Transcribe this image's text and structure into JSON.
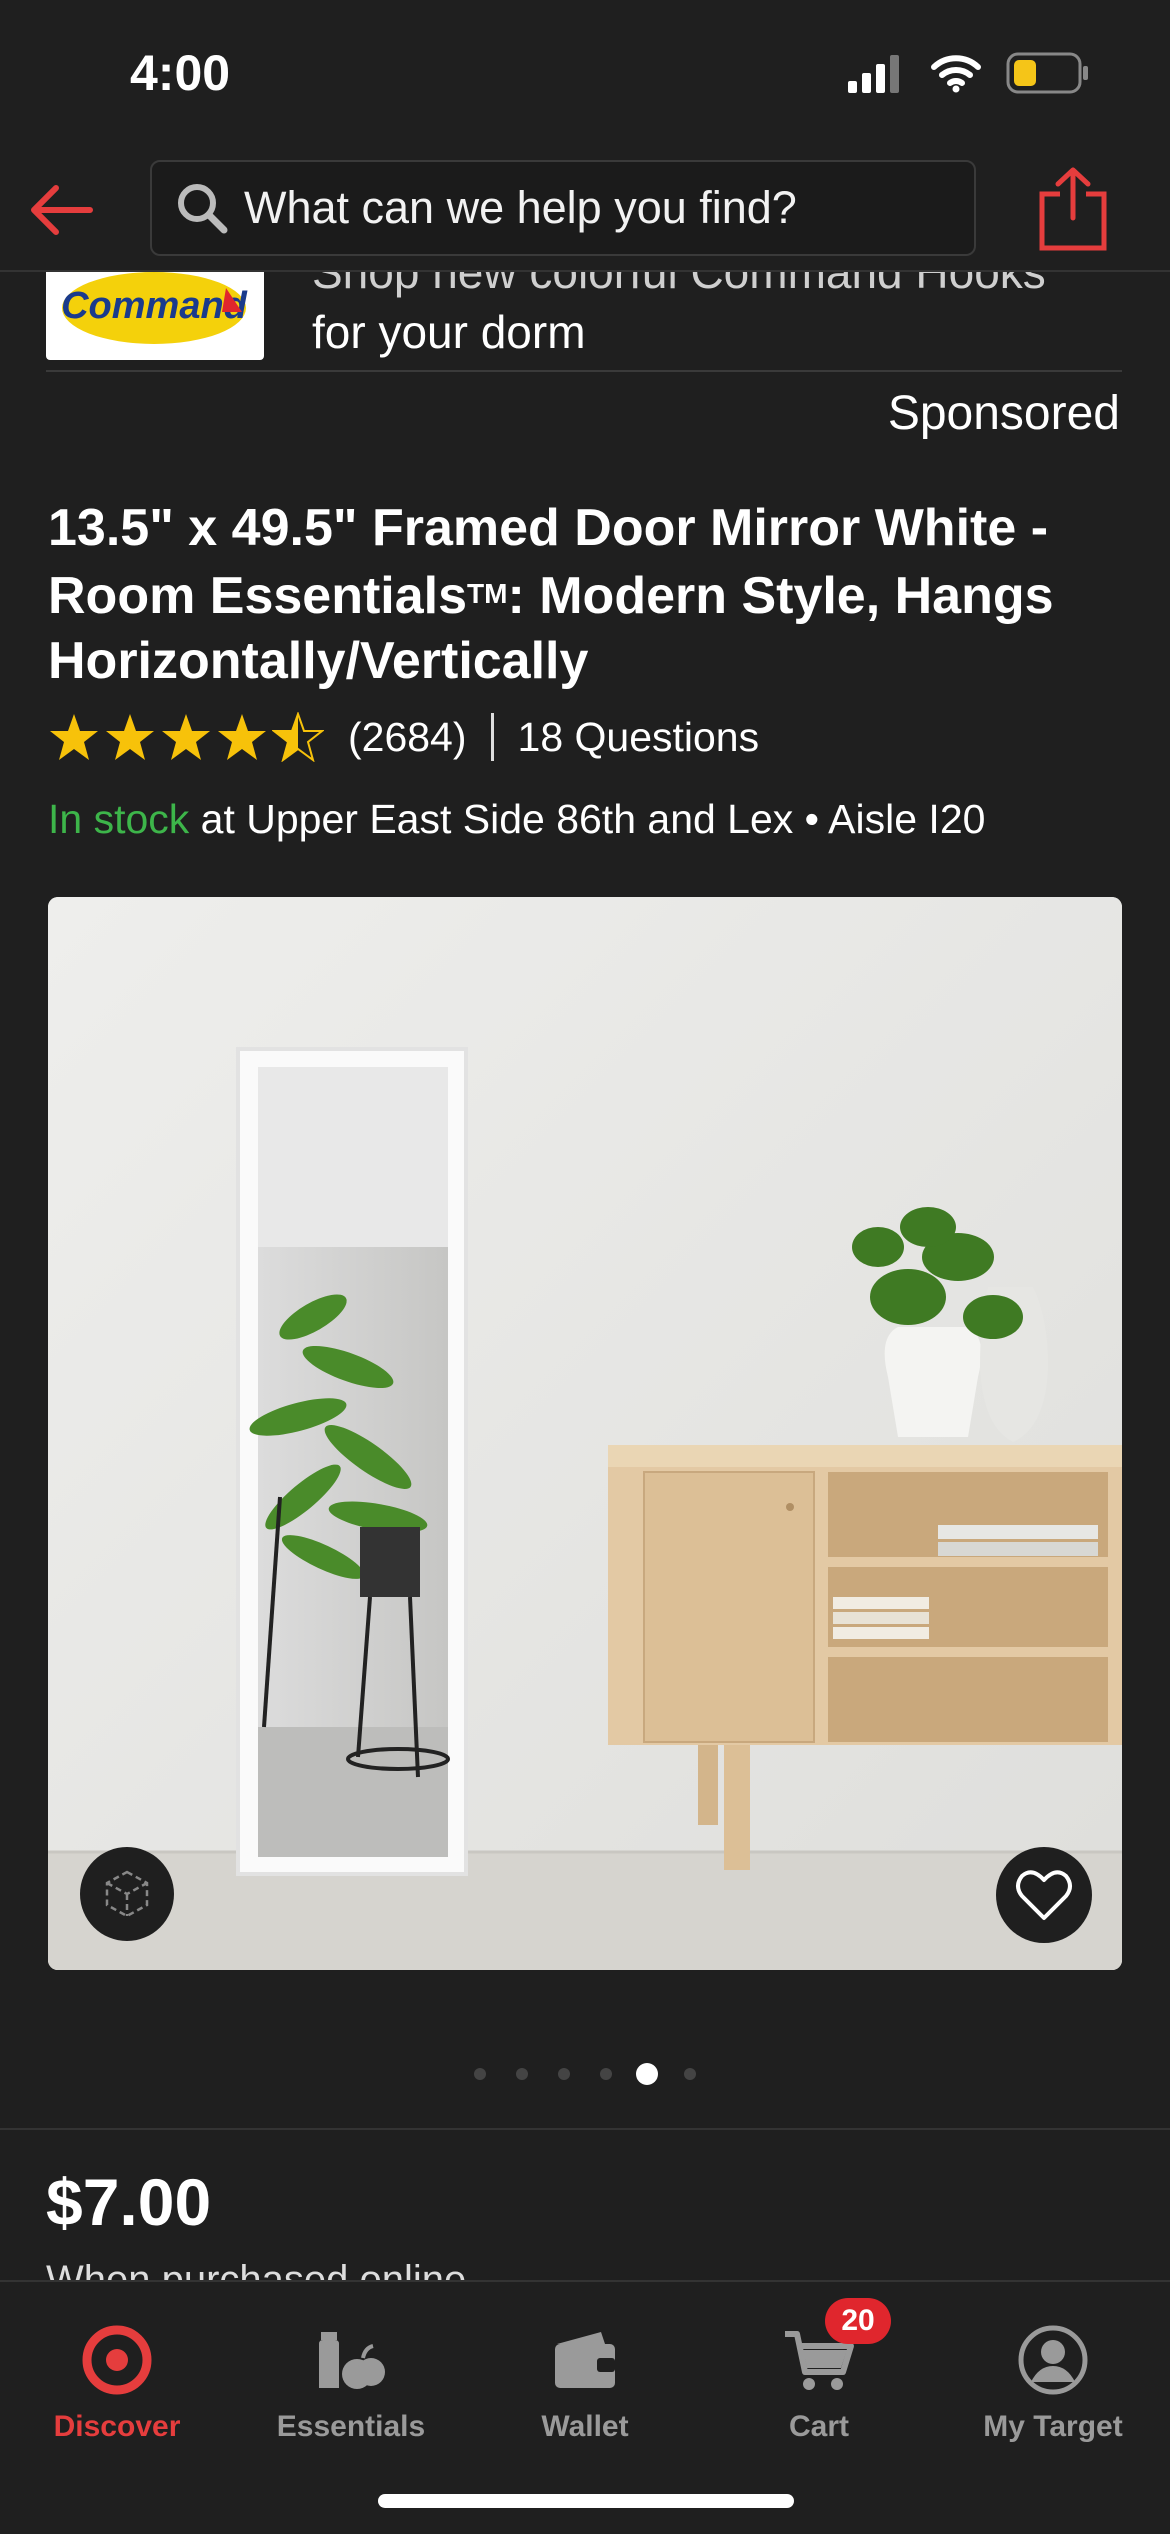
{
  "status": {
    "time": "4:00"
  },
  "search": {
    "placeholder": "What can we help you find?"
  },
  "promo": {
    "brand": "Command",
    "line1": "Shop new colorful Command Hooks",
    "line2": "for your dorm"
  },
  "sponsored_label": "Sponsored",
  "product": {
    "title_a": "13.5\" x 49.5\" Framed Door Mirror White - Room Essentials",
    "title_tm": "TM",
    "title_b": ": Modern Style, Hangs Horizontally/Vertically",
    "rating": 4.5,
    "review_count": "(2684)",
    "questions": "18 Questions",
    "stock_status": "In stock",
    "stock_location": " at Upper East Side 86th and Lex • Aisle I20",
    "price": "$7.00",
    "price_note": "When purchased online"
  },
  "carousel": {
    "count": 6,
    "active_index": 4
  },
  "tabs": [
    {
      "label": "Discover",
      "icon": "target-bullseye-icon",
      "active": true
    },
    {
      "label": "Essentials",
      "icon": "essentials-icon",
      "active": false
    },
    {
      "label": "Wallet",
      "icon": "wallet-icon",
      "active": false
    },
    {
      "label": "Cart",
      "icon": "cart-icon",
      "active": false,
      "badge": "20"
    },
    {
      "label": "My Target",
      "icon": "account-icon",
      "active": false
    }
  ],
  "colors": {
    "accent": "#e53d3d",
    "in_stock": "#3db54a",
    "background": "#1f1f1f",
    "star": "#f7c20a"
  }
}
